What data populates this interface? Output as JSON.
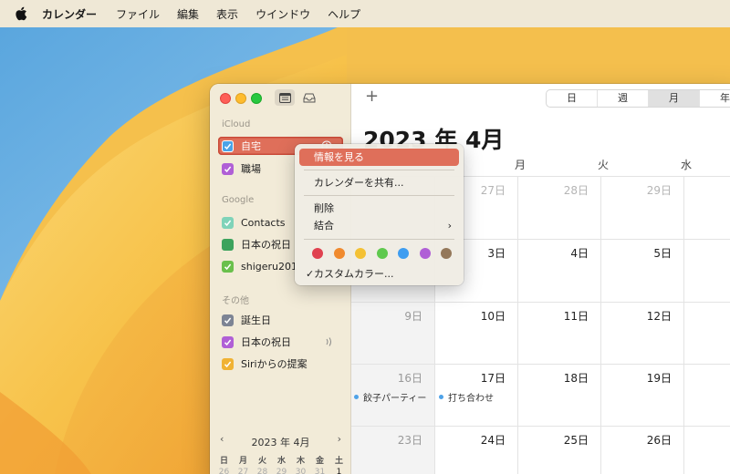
{
  "menubar": {
    "app_name": "カレンダー",
    "items": [
      "ファイル",
      "編集",
      "表示",
      "ウインドウ",
      "ヘルプ"
    ]
  },
  "toolbar": {
    "add_label": "+",
    "views": [
      "日",
      "週",
      "月",
      "年"
    ],
    "active_view": "月"
  },
  "sidebar": {
    "icloud_title": "iCloud",
    "icloud": [
      {
        "label": "自宅",
        "color": "#4aa3e8",
        "checked": true
      },
      {
        "label": "職場",
        "color": "#b05fd6",
        "checked": true
      }
    ],
    "google_title": "Google",
    "google": [
      {
        "label": "Contacts",
        "color": "#7fd3b9",
        "checked": true
      },
      {
        "label": "日本の祝日",
        "color": "#3da35d",
        "checked": false
      },
      {
        "label": "shigeru201",
        "color": "#6ac04c",
        "checked": true
      }
    ],
    "other_title": "その他",
    "other": [
      {
        "label": "誕生日",
        "color": "#7d8494",
        "checked": true
      },
      {
        "label": "日本の祝日",
        "color": "#b05fd6",
        "checked": true
      },
      {
        "label": "Siriからの提案",
        "color": "#f0b233",
        "checked": true
      }
    ]
  },
  "mini_calendar": {
    "title": "2023 年 4月",
    "weekdays": [
      "日",
      "月",
      "火",
      "水",
      "木",
      "金",
      "土"
    ],
    "first_row": [
      "26",
      "27",
      "28",
      "29",
      "30",
      "31",
      "1"
    ]
  },
  "main": {
    "month_title": "2023 年 4月",
    "weekdays": [
      "月",
      "火",
      "水"
    ],
    "rows": [
      [
        {
          "day": "",
          "style": "dim"
        },
        {
          "day": "27日",
          "style": "dim"
        },
        {
          "day": "28日",
          "style": "dim"
        },
        {
          "day": "29日",
          "style": "dim"
        }
      ],
      [
        {
          "day": "",
          "style": "sun"
        },
        {
          "day": "3日",
          "style": "cur"
        },
        {
          "day": "4日",
          "style": "cur"
        },
        {
          "day": "5日",
          "style": "cur"
        }
      ],
      [
        {
          "day": "9日",
          "style": "sun"
        },
        {
          "day": "10日",
          "style": "cur"
        },
        {
          "day": "11日",
          "style": "cur"
        },
        {
          "day": "12日",
          "style": "cur"
        }
      ],
      [
        {
          "day": "16日",
          "style": "sun"
        },
        {
          "day": "17日",
          "style": "cur"
        },
        {
          "day": "18日",
          "style": "cur"
        },
        {
          "day": "19日",
          "style": "cur"
        }
      ],
      [
        {
          "day": "23日",
          "style": "sun"
        },
        {
          "day": "24日",
          "style": "cur"
        },
        {
          "day": "25日",
          "style": "cur"
        },
        {
          "day": "26日",
          "style": "cur"
        }
      ]
    ],
    "events": [
      {
        "title": "餃子パーティー",
        "day": "16日",
        "color": "#4ea2e8"
      },
      {
        "title": "打ち合わせ",
        "day": "17日",
        "color": "#4ea2e8"
      }
    ]
  },
  "context_menu": {
    "get_info": "情報を見る",
    "share": "カレンダーを共有...",
    "delete": "削除",
    "merge": "結合",
    "custom_color": "カスタムカラー...",
    "check_mark": "✓",
    "submenu_arrow": "›",
    "colors": [
      "#e0414f",
      "#f08a2e",
      "#f4c134",
      "#5fc94e",
      "#3f9df0",
      "#b05fd6",
      "#94785a"
    ]
  }
}
